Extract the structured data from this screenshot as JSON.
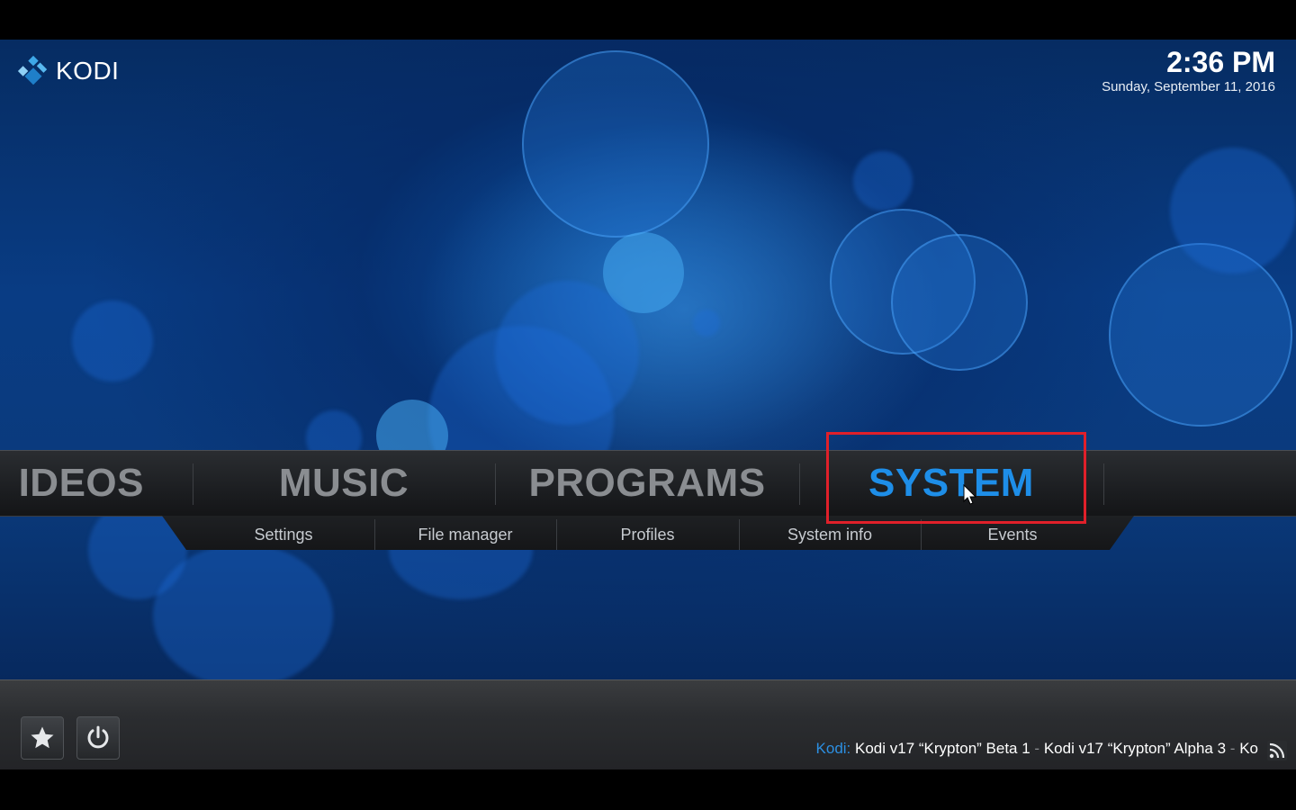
{
  "app": {
    "logo_text": "KODI"
  },
  "clock": {
    "time": "2:36 PM",
    "date": "Sunday, September 11, 2016"
  },
  "main_menu": {
    "items": [
      {
        "label": "IDEOS"
      },
      {
        "label": "MUSIC"
      },
      {
        "label": "PROGRAMS"
      },
      {
        "label": "SYSTEM",
        "active": true
      }
    ]
  },
  "sub_menu": {
    "items": [
      {
        "label": "Settings"
      },
      {
        "label": "File manager"
      },
      {
        "label": "Profiles"
      },
      {
        "label": "System info"
      },
      {
        "label": "Events"
      }
    ]
  },
  "bottom": {
    "favourites_icon": "star-icon",
    "power_icon": "power-icon",
    "ticker_source": "Kodi:",
    "ticker_items": [
      "Kodi v17 “Krypton” Beta 1",
      "Kodi v17 “Krypton” Alpha 3",
      "Ko"
    ],
    "ticker_separator": "-",
    "rss_icon": "rss-icon"
  },
  "colors": {
    "accent": "#1e8ee8",
    "highlight_box": "#e0202a",
    "menu_inactive": "#8a8d91"
  }
}
